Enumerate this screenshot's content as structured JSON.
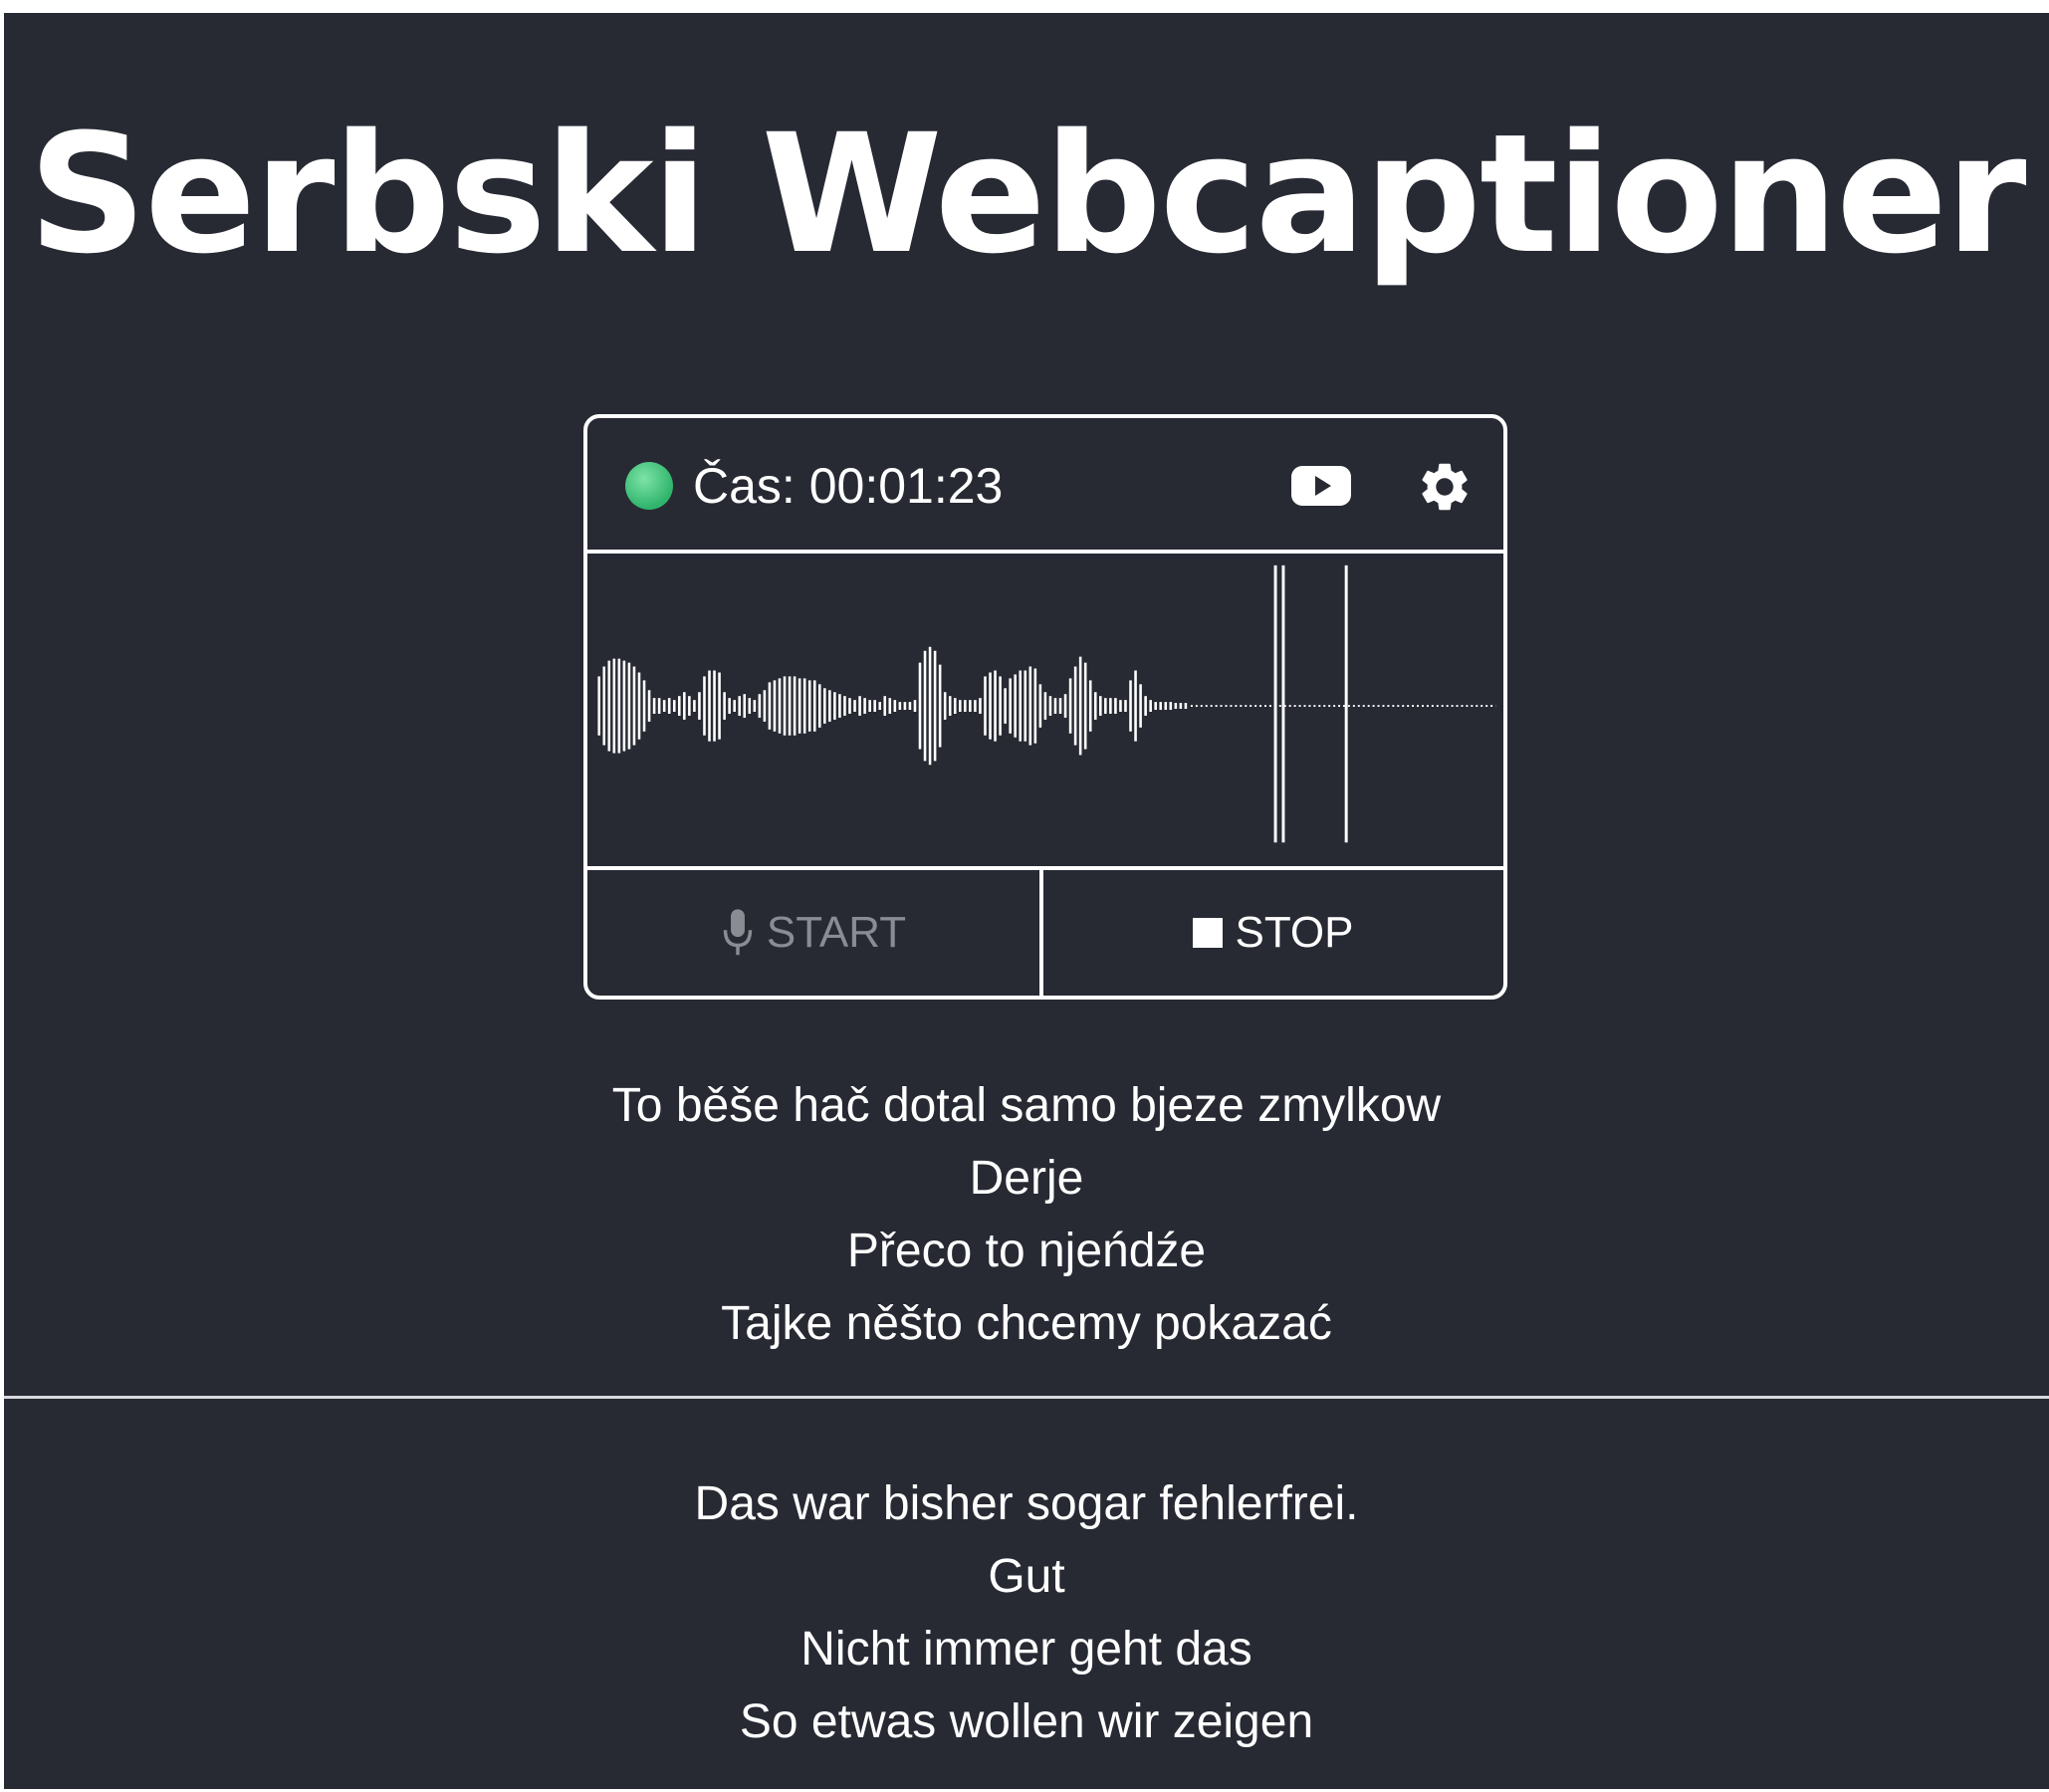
{
  "app": {
    "title": "Serbski Webcaptioner"
  },
  "recorder": {
    "status": "recording",
    "status_color": "#3cc47c",
    "timer_label": "Čas: 00:01:23",
    "icons": [
      "youtube-icon",
      "gear-icon"
    ],
    "start_label": "START",
    "stop_label": "STOP",
    "start_enabled": false,
    "stop_enabled": true
  },
  "captions": {
    "sorbian": [
      "To běše hač dotal samo bjeze zmylkow",
      "Derje",
      "Přeco to njeńdźe",
      "Tajke něšto chcemy pokazać"
    ],
    "german": [
      "Das war bisher sogar fehlerfrei.",
      "Gut",
      "Nicht immer geht das",
      "So etwas wollen wir zeigen"
    ]
  },
  "colors": {
    "background": "#272a33",
    "foreground": "#ffffff",
    "disabled": "#8a8c93"
  }
}
